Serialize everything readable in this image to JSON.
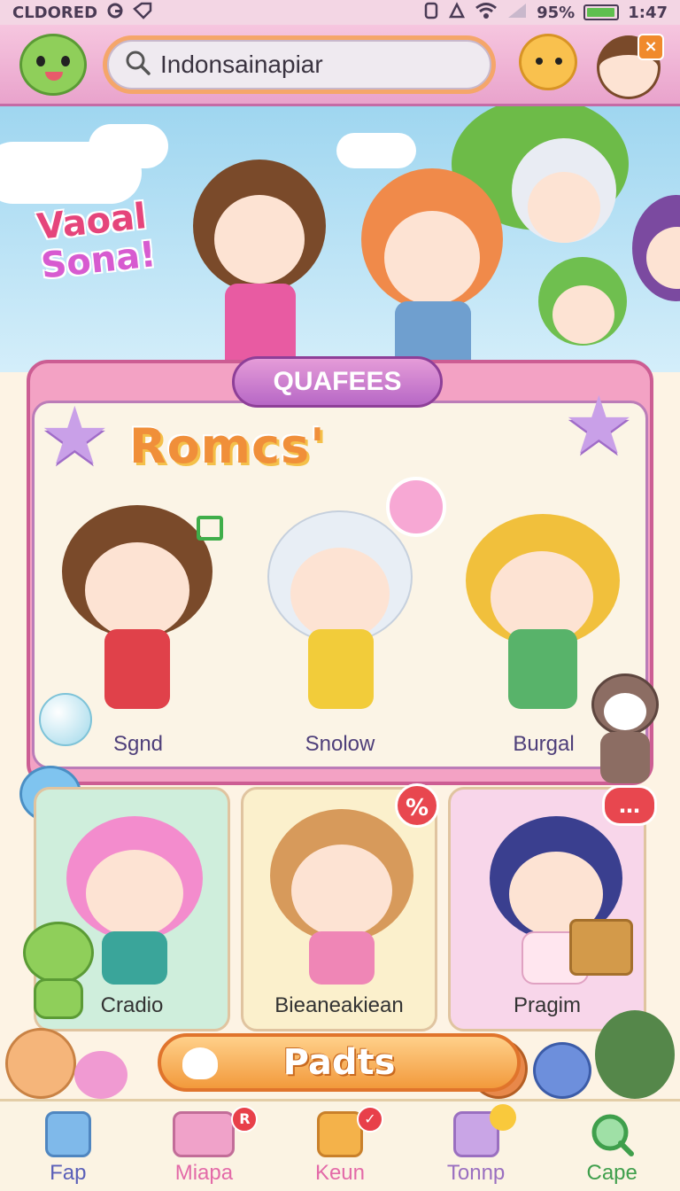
{
  "status_bar": {
    "carrier": "CLDORED",
    "battery_percent": "95%",
    "battery_level": 0.95,
    "time": "1:47",
    "icons": [
      "g-icon",
      "tag-icon",
      "nfc-icon",
      "signal-icon",
      "wifi-icon",
      "cell-signal-icon",
      "battery-icon"
    ]
  },
  "header": {
    "search": {
      "value": "Indonsainapiar",
      "icon": "search-icon"
    },
    "close_symbol": "×"
  },
  "hero": {
    "title_line1": "Vaoal",
    "title_line2": "Sona!"
  },
  "panel": {
    "tab_label": "QUAFEES",
    "section_title": "Romcs'",
    "characters": [
      {
        "name": "Sgnd",
        "hair": "#7a4a2a",
        "outfit": "#e0414a"
      },
      {
        "name": "Snolow",
        "hair": "#e8eef5",
        "outfit": "#f2cc3a"
      },
      {
        "name": "Burgal",
        "hair": "#f1c03c",
        "outfit": "#58b36a"
      }
    ]
  },
  "cards": [
    {
      "name": "Cradio",
      "bg": "#cfeedc",
      "hair": "#f38ccd",
      "outfit": "#3aa59a"
    },
    {
      "name": "Bieaneakiean",
      "bg": "#fbf0cc",
      "hair": "#d79a5b",
      "outfit": "#ef86b6",
      "badge": "%"
    },
    {
      "name": "Pragim",
      "bg": "#f8d6ea",
      "hair": "#3a3f8f",
      "outfit": "#ffe6ef",
      "badge": "…"
    }
  ],
  "cta": {
    "label": "Padts"
  },
  "nav": [
    {
      "label": "Fap",
      "icon": "key-icon",
      "color": "#7fb9ea"
    },
    {
      "label": "Miapa",
      "icon": "shop-icon",
      "color": "#f0a2c9",
      "badge": "R"
    },
    {
      "label": "Keun",
      "icon": "gift-icon",
      "color": "#f4b24a",
      "badge": "✓"
    },
    {
      "label": "Tonnp",
      "icon": "map-icon",
      "color": "#c9a5e6"
    },
    {
      "label": "Cape",
      "icon": "search-icon",
      "color": "#6cc67a"
    }
  ],
  "colors": {
    "accent": "#e9a3cc",
    "brand_orange": "#f29a3c",
    "panel": "#f3a2c4"
  }
}
